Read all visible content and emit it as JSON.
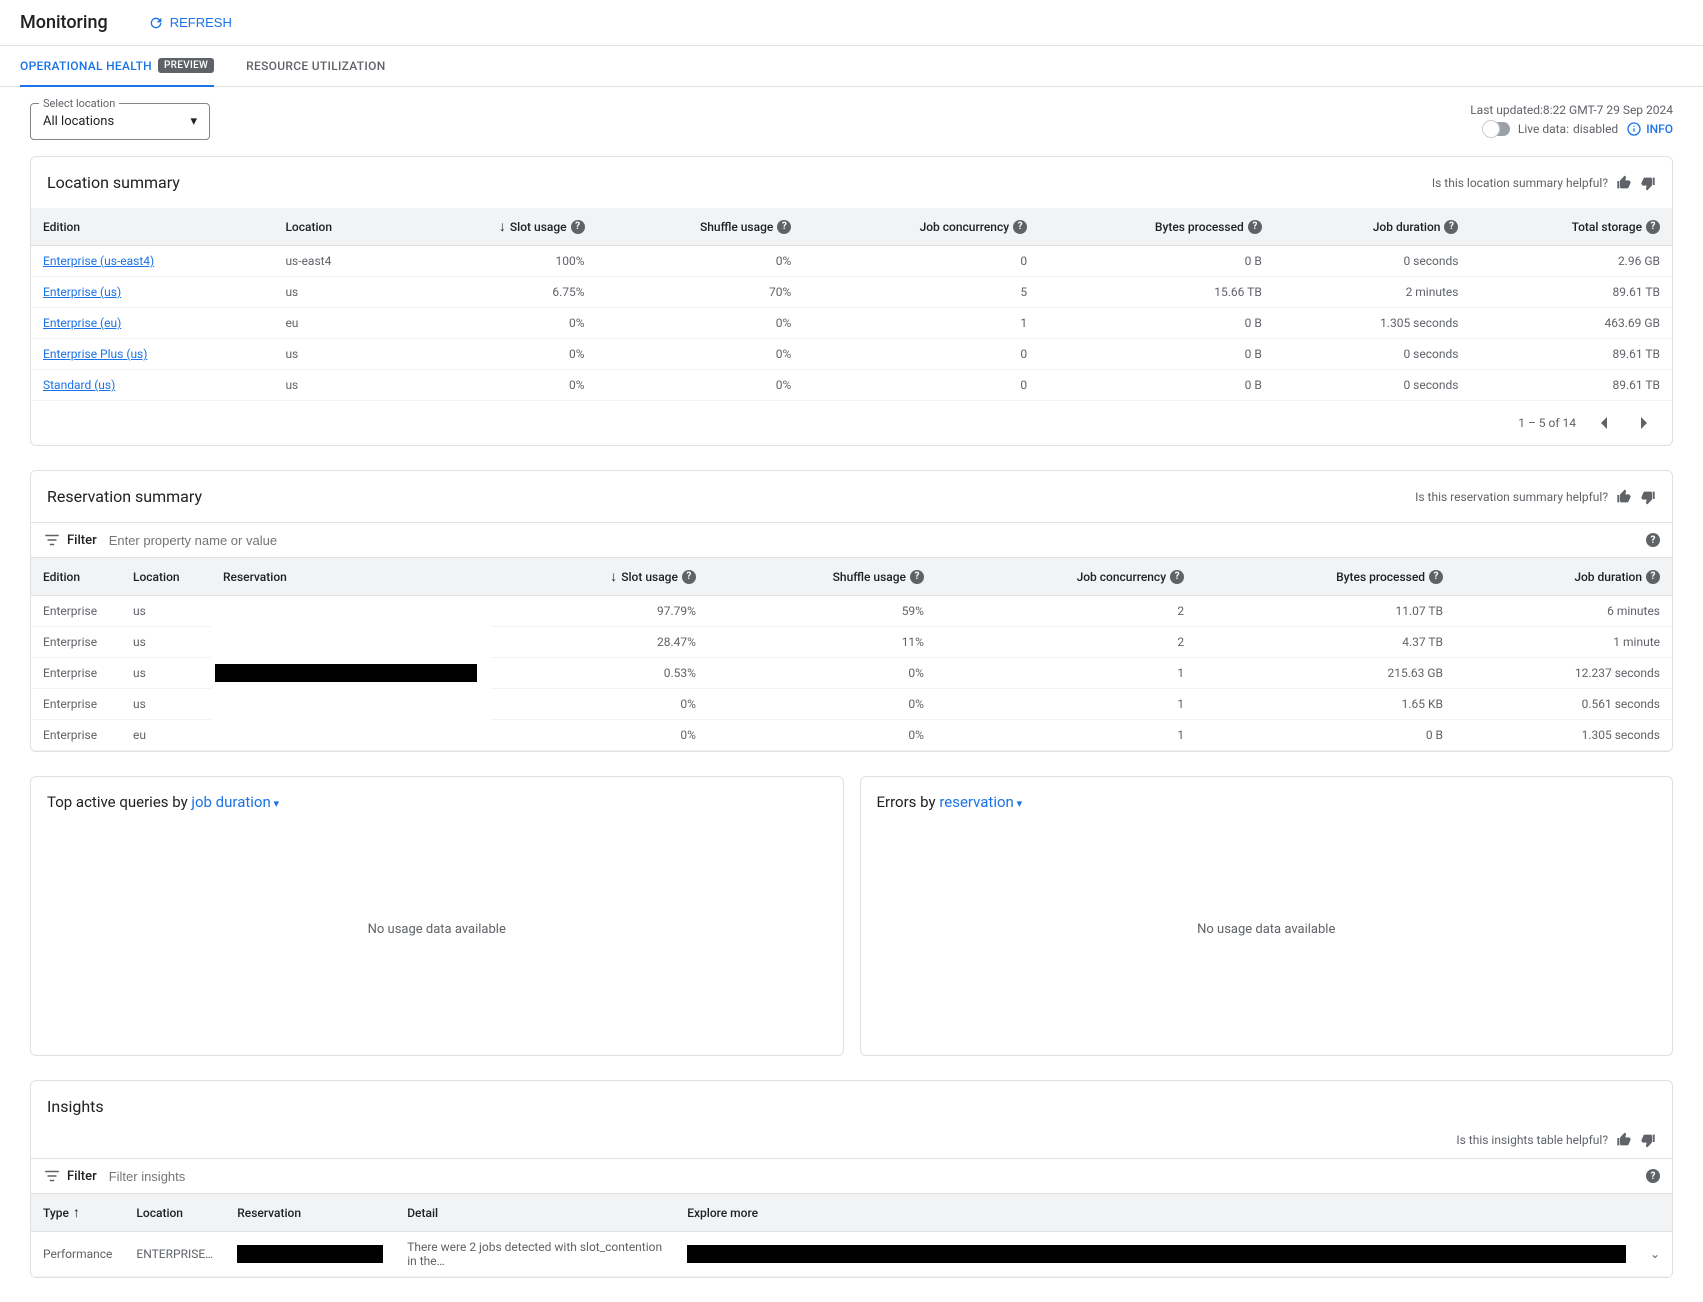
{
  "header": {
    "title": "Monitoring",
    "refresh": "REFRESH"
  },
  "tabs": {
    "t1": "OPERATIONAL HEALTH",
    "badge": "PREVIEW",
    "t2": "RESOURCE UTILIZATION"
  },
  "toolbar": {
    "select_label": "Select location",
    "select_value": "All locations",
    "last_updated": "Last updated:8:22 GMT-7 29 Sep 2024",
    "live_data_label": "Live data:",
    "live_data_value": "disabled",
    "info": "INFO"
  },
  "location_summary": {
    "title": "Location summary",
    "helpful": "Is this location summary helpful?",
    "cols": {
      "edition": "Edition",
      "location": "Location",
      "slot": "Slot usage",
      "shuffle": "Shuffle usage",
      "job": "Job concurrency",
      "bytes": "Bytes processed",
      "duration": "Job duration",
      "storage": "Total storage"
    },
    "rows": [
      {
        "edition": "Enterprise (us-east4)",
        "location": "us-east4",
        "slot": "100%",
        "shuffle": "0%",
        "job": "0",
        "bytes": "0 B",
        "duration": "0 seconds",
        "storage": "2.96 GB"
      },
      {
        "edition": "Enterprise (us)",
        "location": "us",
        "slot": "6.75%",
        "shuffle": "70%",
        "job": "5",
        "bytes": "15.66 TB",
        "duration": "2 minutes",
        "storage": "89.61 TB"
      },
      {
        "edition": "Enterprise (eu)",
        "location": "eu",
        "slot": "0%",
        "shuffle": "0%",
        "job": "1",
        "bytes": "0 B",
        "duration": "1.305 seconds",
        "storage": "463.69 GB"
      },
      {
        "edition": "Enterprise Plus (us)",
        "location": "us",
        "slot": "0%",
        "shuffle": "0%",
        "job": "0",
        "bytes": "0 B",
        "duration": "0 seconds",
        "storage": "89.61 TB"
      },
      {
        "edition": "Standard (us)",
        "location": "us",
        "slot": "0%",
        "shuffle": "0%",
        "job": "0",
        "bytes": "0 B",
        "duration": "0 seconds",
        "storage": "89.61 TB"
      }
    ],
    "pagination": "1 – 5 of 14"
  },
  "reservation_summary": {
    "title": "Reservation summary",
    "helpful": "Is this reservation summary helpful?",
    "filter_label": "Filter",
    "filter_placeholder": "Enter property name or value",
    "cols": {
      "edition": "Edition",
      "location": "Location",
      "reservation": "Reservation",
      "slot": "Slot usage",
      "shuffle": "Shuffle usage",
      "job": "Job concurrency",
      "bytes": "Bytes processed",
      "duration": "Job duration"
    },
    "rows": [
      {
        "edition": "Enterprise",
        "location": "us",
        "slot": "97.79%",
        "shuffle": "59%",
        "job": "2",
        "bytes": "11.07 TB",
        "duration": "6 minutes"
      },
      {
        "edition": "Enterprise",
        "location": "us",
        "slot": "28.47%",
        "shuffle": "11%",
        "job": "2",
        "bytes": "4.37 TB",
        "duration": "1 minute"
      },
      {
        "edition": "Enterprise",
        "location": "us",
        "slot": "0.53%",
        "shuffle": "0%",
        "job": "1",
        "bytes": "215.63 GB",
        "duration": "12.237 seconds"
      },
      {
        "edition": "Enterprise",
        "location": "us",
        "slot": "0%",
        "shuffle": "0%",
        "job": "1",
        "bytes": "1.65 KB",
        "duration": "0.561 seconds"
      },
      {
        "edition": "Enterprise",
        "location": "eu",
        "slot": "0%",
        "shuffle": "0%",
        "job": "1",
        "bytes": "0 B",
        "duration": "1.305 seconds"
      }
    ]
  },
  "panels": {
    "queries_prefix": "Top active queries by ",
    "queries_dd": "job duration",
    "errors_prefix": "Errors by ",
    "errors_dd": "reservation",
    "empty": "No usage data available"
  },
  "insights": {
    "title": "Insights",
    "helpful": "Is this insights table helpful?",
    "filter_label": "Filter",
    "filter_placeholder": "Filter insights",
    "cols": {
      "type": "Type",
      "location": "Location",
      "reservation": "Reservation",
      "detail": "Detail",
      "explore": "Explore more"
    },
    "rows": [
      {
        "type": "Performance",
        "location": "ENTERPRISE…",
        "detail": "There were 2 jobs detected with slot_contention in the…"
      }
    ]
  }
}
